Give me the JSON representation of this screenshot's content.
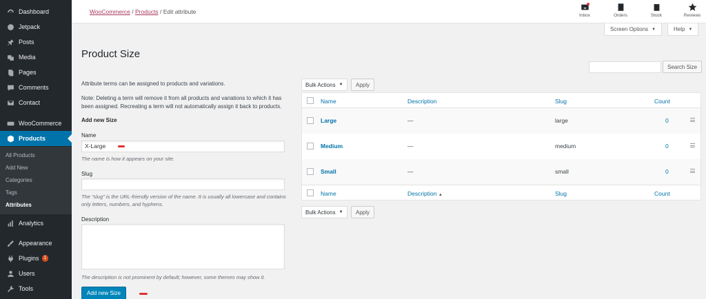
{
  "sidebar": {
    "items": [
      {
        "label": "Dashboard",
        "icon": "dashboard-icon"
      },
      {
        "label": "Jetpack",
        "icon": "jetpack-icon"
      },
      {
        "label": "Posts",
        "icon": "pin-icon"
      },
      {
        "label": "Media",
        "icon": "media-icon"
      },
      {
        "label": "Pages",
        "icon": "page-icon"
      },
      {
        "label": "Comments",
        "icon": "comment-icon"
      },
      {
        "label": "Contact",
        "icon": "mail-icon"
      },
      {
        "label": "WooCommerce",
        "icon": "woo-icon"
      },
      {
        "label": "Products",
        "icon": "box-icon"
      },
      {
        "label": "Analytics",
        "icon": "bar-chart-icon"
      },
      {
        "label": "Appearance",
        "icon": "brush-icon"
      },
      {
        "label": "Plugins",
        "icon": "plug-icon",
        "badge": "1"
      },
      {
        "label": "Users",
        "icon": "user-icon"
      },
      {
        "label": "Tools",
        "icon": "wrench-icon"
      }
    ],
    "submenu": [
      "All Products",
      "Add New",
      "Categories",
      "Tags",
      "Attributes"
    ]
  },
  "topbar": {
    "breadcrumb": {
      "link1": "WooCommerce",
      "sep": "/",
      "link2": "Products",
      "current": "Edit attribute"
    },
    "buttons": {
      "inbox": "Inbox",
      "orders": "Orders",
      "stock": "Stock",
      "reviews": "Reviews"
    }
  },
  "screen_options": "Screen Options",
  "help": "Help",
  "page_title": "Product Size",
  "form": {
    "intro": "Attribute terms can be assigned to products and variations.",
    "note": "Note: Deleting a term will remove it from all products and variations to which it has been assigned. Recreating a term will not automatically assign it back to products.",
    "heading": "Add new Size",
    "name_label": "Name",
    "name_value": "X-Large",
    "name_help": "The name is how it appears on your site.",
    "slug_label": "Slug",
    "slug_value": "",
    "slug_help": "The “slug” is the URL-friendly version of the name. It is usually all lowercase and contains only letters, numbers, and hyphens.",
    "description_label": "Description",
    "description_help": "The description is not prominent by default; however, some themes may show it.",
    "submit": "Add new Size"
  },
  "table": {
    "search_button": "Search Size",
    "bulk_actions": "Bulk Actions",
    "apply": "Apply",
    "columns": {
      "name": "Name",
      "description": "Description",
      "slug": "Slug",
      "count": "Count"
    },
    "rows": [
      {
        "name": "Large",
        "description": "—",
        "slug": "large",
        "count": "0"
      },
      {
        "name": "Medium",
        "description": "—",
        "slug": "medium",
        "count": "0"
      },
      {
        "name": "Small",
        "description": "—",
        "slug": "small",
        "count": "0"
      }
    ]
  },
  "colors": {
    "sidebar_bg": "#23282d",
    "accent": "#0073aa",
    "primary_button": "#0085ba",
    "breadcrumb_link": "#a8385d",
    "badge": "#d54e21"
  }
}
